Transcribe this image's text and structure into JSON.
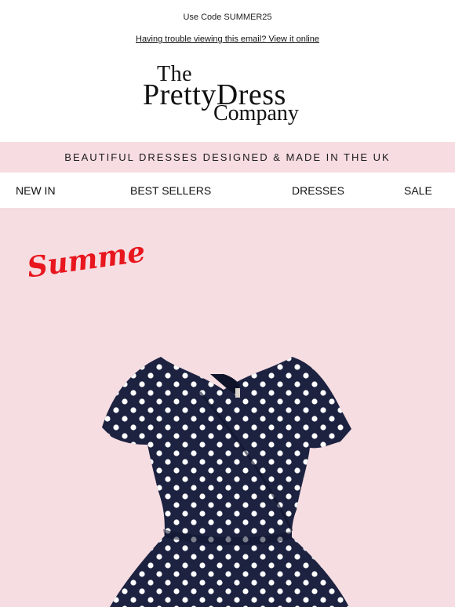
{
  "header": {
    "promo_text": "Use Code SUMMER25",
    "view_online_text": "Having trouble viewing this email? View it online"
  },
  "logo": {
    "line1": "The",
    "line2": "PrettyDress",
    "line3": "Company"
  },
  "tagline": "BEAUTIFUL DRESSES DESIGNED & MADE IN THE UK",
  "nav": {
    "items": [
      "NEW IN",
      "BEST SELLERS",
      "DRESSES",
      "SALE"
    ]
  },
  "hero": {
    "script_text": "Summe",
    "background": "#f6dde1",
    "accent": "#e8161e",
    "dress_color": "#1c2240",
    "dot_color": "#ffffff"
  }
}
